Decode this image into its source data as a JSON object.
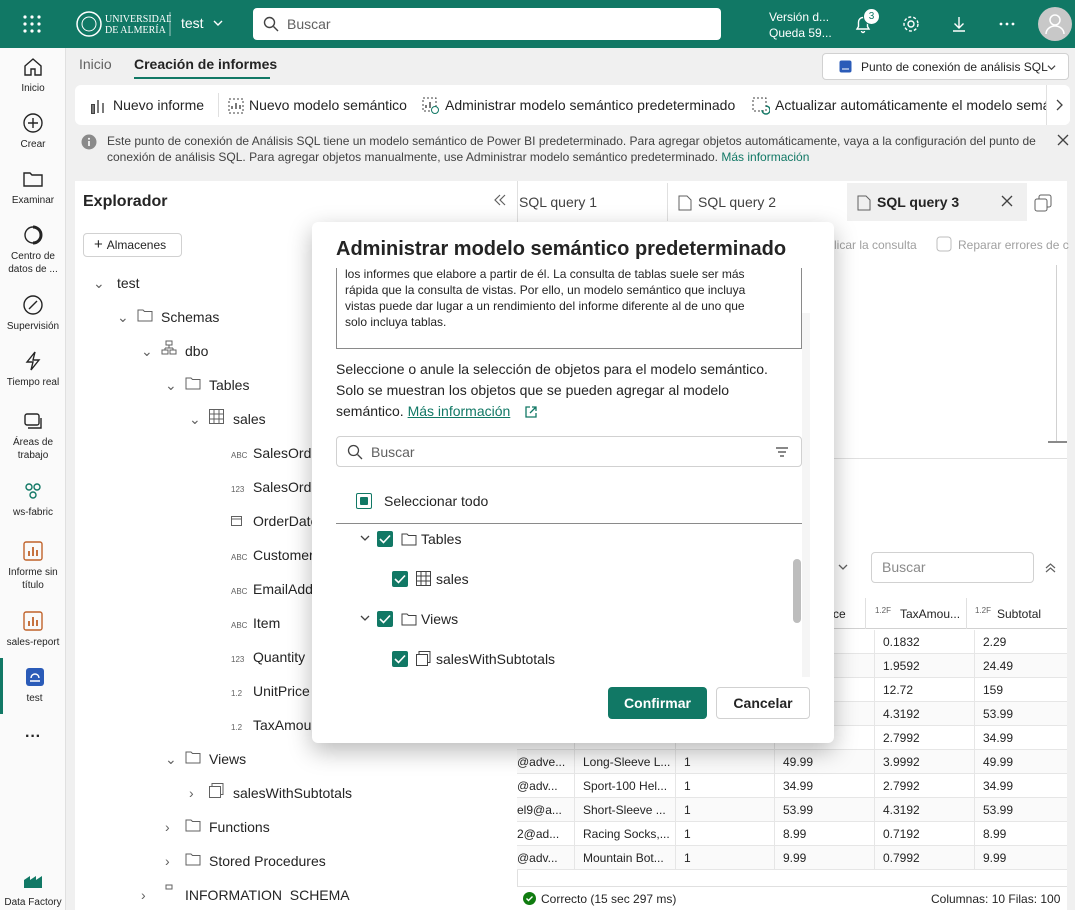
{
  "topbar": {
    "workspace": "test",
    "search_placeholder": "Buscar",
    "trial_line1": "Versión d...",
    "trial_line2": "Queda 59...",
    "notification_count": "3"
  },
  "rail": {
    "items": [
      {
        "label": "Inicio"
      },
      {
        "label": "Crear"
      },
      {
        "label": "Examinar"
      },
      {
        "label": "Centro de datos de ..."
      },
      {
        "label": "Supervisión"
      },
      {
        "label": "Tiempo real"
      },
      {
        "label": "Áreas de trabajo"
      },
      {
        "label": "ws-fabric"
      },
      {
        "label": "Informe sin título"
      },
      {
        "label": "sales-report"
      },
      {
        "label": "test"
      },
      {
        "label": "Data Factory"
      }
    ]
  },
  "ribbon": {
    "tabs": [
      "Inicio",
      "Creación de informes"
    ],
    "endpoint": "Punto de conexión de análisis SQL",
    "buttons": [
      "Nuevo informe",
      "Nuevo modelo semántico",
      "Administrar modelo semántico predeterminado",
      "Actualizar automáticamente el modelo semá"
    ]
  },
  "infobar": {
    "text": "Este punto de conexión de Análisis SQL tiene un modelo semántico de Power BI predeterminado. Para agregar objetos automáticamente, vaya a la configuración del punto de conexión de análisis SQL. Para agregar objetos manualmente, use Administrar modelo semántico predeterminado.",
    "link": "Más información"
  },
  "explorer": {
    "title": "Explorador",
    "add_button": "Almacenes",
    "tree": [
      {
        "label": "test"
      },
      {
        "label": "Schemas"
      },
      {
        "label": "dbo"
      },
      {
        "label": "Tables"
      },
      {
        "label": "sales"
      },
      {
        "label": "SalesOrde",
        "type": "ABC"
      },
      {
        "label": "SalesOrde",
        "type": "123"
      },
      {
        "label": "OrderDate",
        "type": "date"
      },
      {
        "label": "Customer",
        "type": "ABC"
      },
      {
        "label": "EmailAdd",
        "type": "ABC"
      },
      {
        "label": "Item",
        "type": "ABC"
      },
      {
        "label": "Quantity",
        "type": "123"
      },
      {
        "label": "UnitPrice",
        "type": "1.2"
      },
      {
        "label": "TaxAmour",
        "type": "1.2"
      },
      {
        "label": "Views"
      },
      {
        "label": "salesWithSubtotals"
      },
      {
        "label": "Functions"
      },
      {
        "label": "Stored Procedures"
      },
      {
        "label": "INFORMATION_SCHEMA"
      }
    ]
  },
  "editor": {
    "tabs": [
      "SQL query 1",
      "SQL query 2",
      "SQL query 3"
    ],
    "actions": [
      "licar la consulta",
      "Reparar errores de c"
    ],
    "result_search_placeholder": "Buscar",
    "columns": [
      {
        "type": "",
        "label": "ce"
      },
      {
        "type": "1.2F",
        "label": "TaxAmou..."
      },
      {
        "type": "1.2F",
        "label": "Subtotal"
      }
    ],
    "rows": [
      [
        "",
        "",
        "",
        "",
        "0.1832",
        "2.29"
      ],
      [
        "",
        "",
        "",
        "",
        "1.9592",
        "24.49"
      ],
      [
        "",
        "",
        "",
        "",
        "12.72",
        "159"
      ],
      [
        "",
        "",
        "",
        "",
        "4.3192",
        "53.99"
      ],
      [
        "",
        "",
        "",
        "",
        "2.7992",
        "34.99"
      ],
      [
        "@adve...",
        "Long-Sleeve L...",
        "1",
        "49.99",
        "3.9992",
        "49.99"
      ],
      [
        "@adv...",
        "Sport-100 Hel...",
        "1",
        "34.99",
        "2.7992",
        "34.99"
      ],
      [
        "el9@a...",
        "Short-Sleeve ...",
        "1",
        "53.99",
        "4.3192",
        "53.99"
      ],
      [
        "2@ad...",
        "Racing Socks,...",
        "1",
        "8.99",
        "0.7192",
        "8.99"
      ],
      [
        "@adv...",
        "Mountain Bot...",
        "1",
        "9.99",
        "0.7992",
        "9.99"
      ]
    ],
    "status": "Correcto (15 sec 297 ms)",
    "summary": "Columnas: 10 Filas: 100"
  },
  "dialog": {
    "title": "Administrar modelo semántico predeterminado",
    "notice_lines": [
      "los informes que elabore a partir de él. La consulta de tablas suele ser más",
      "rápida que la consulta de vistas. Por ello, un modelo semántico que incluya",
      "vistas puede dar lugar a un rendimiento del informe diferente al de uno que",
      "solo incluya tablas."
    ],
    "description": "Seleccione o anule la selección de objetos para el modelo semántico. Solo se muestran los objetos que se pueden agregar al modelo semántico.",
    "more_info": "Más información",
    "search_placeholder": "Buscar",
    "select_all": "Seleccionar todo",
    "tree": [
      {
        "label": "Tables"
      },
      {
        "label": "sales"
      },
      {
        "label": "Views"
      },
      {
        "label": "salesWithSubtotals"
      }
    ],
    "confirm": "Confirmar",
    "cancel": "Cancelar"
  },
  "colors": {
    "brand": "#117865",
    "dialog_bg": "#ffffff"
  }
}
